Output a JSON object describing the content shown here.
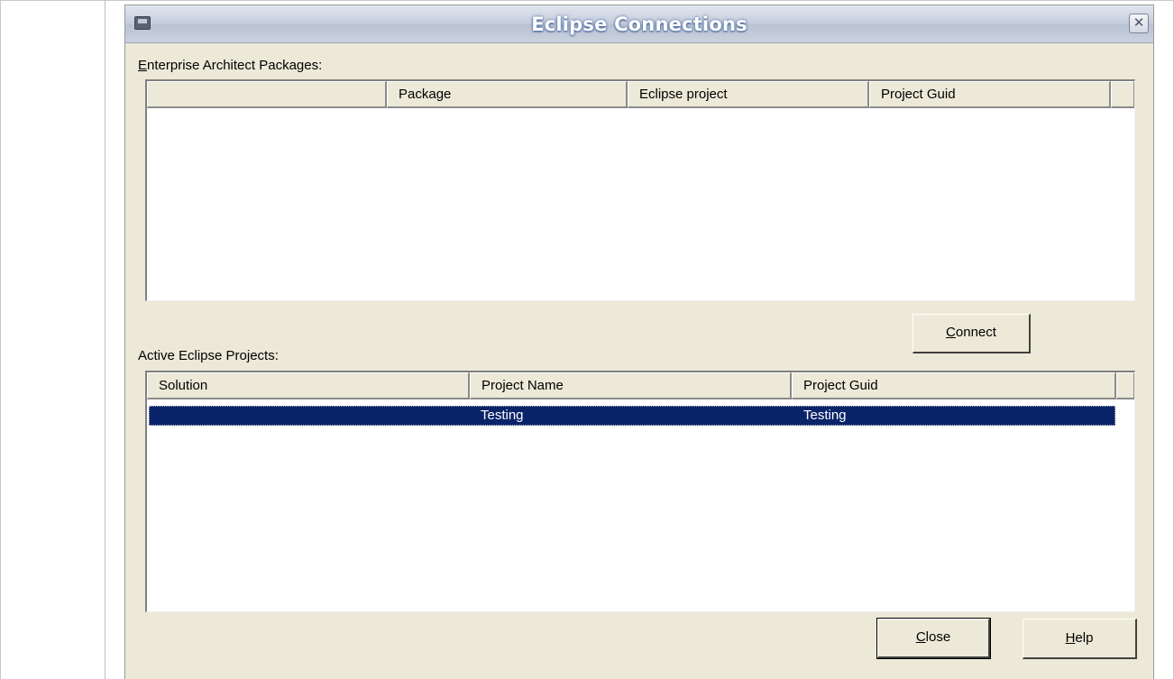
{
  "window": {
    "title": "Eclipse Connections",
    "close_glyph": "✕"
  },
  "packages": {
    "label_accel": "E",
    "label_rest": "nterprise Architect Packages:",
    "columns": [
      "",
      "Package",
      "Eclipse project",
      "Project Guid",
      ""
    ]
  },
  "connect_button": {
    "accel": "C",
    "rest": "onnect"
  },
  "projects": {
    "label": "Active Eclipse Projects:",
    "columns": [
      "Solution",
      "Project Name",
      "Project Guid",
      ""
    ],
    "rows": [
      {
        "solution": "",
        "project_name": "Testing",
        "project_guid": "Testing",
        "selected": true
      }
    ]
  },
  "footer": {
    "close_accel": "C",
    "close_rest": "lose",
    "help_accel": "H",
    "help_rest": "elp"
  },
  "colors": {
    "dialog_bg": "#ece9d8",
    "selection": "#0a246a",
    "title_text": "#ffffff"
  }
}
